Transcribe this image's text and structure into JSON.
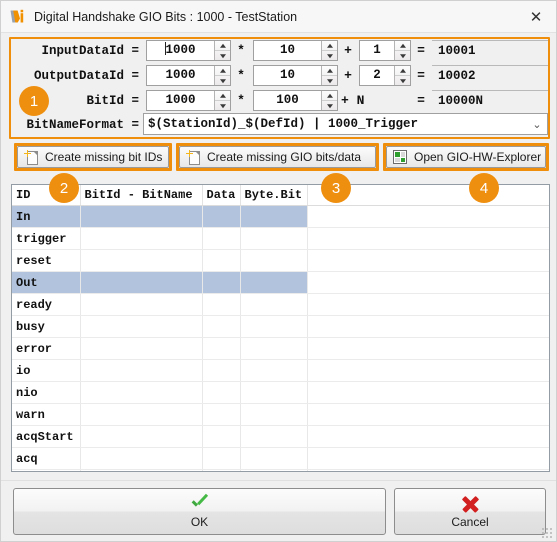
{
  "window": {
    "title": "Digital Handshake GIO Bits : 1000 - TestStation",
    "icon": "app-logo-icon",
    "close_label": "✕"
  },
  "accent_color": "#ef8f10",
  "selection_color": "#b2c4dd",
  "formula": {
    "rows": [
      {
        "label": "InputDataId =",
        "base": "1000",
        "mul_op": "*",
        "factor": "10",
        "add_op": "+",
        "offset": "1",
        "eq_op": "=",
        "result": "10001",
        "has_caret": true,
        "offset_is_spinner": true
      },
      {
        "label": "OutputDataId =",
        "base": "1000",
        "mul_op": "*",
        "factor": "10",
        "add_op": "+",
        "offset": "2",
        "eq_op": "=",
        "result": "10002",
        "has_caret": false,
        "offset_is_spinner": true
      },
      {
        "label": "BitId =",
        "base": "1000",
        "mul_op": "*",
        "factor": "100",
        "add_op": "+ N",
        "offset": "",
        "eq_op": "=",
        "result": "10000N",
        "has_caret": false,
        "offset_is_spinner": false
      }
    ],
    "bitnameformat": {
      "label": "BitNameFormat =",
      "value": "$(StationId)_$(DefId) | 1000_Trigger",
      "arrow": "⌄"
    }
  },
  "actions": [
    {
      "label": "Create missing bit IDs",
      "icon": "new-document-icon"
    },
    {
      "label": "Create missing GIO bits/data",
      "icon": "new-document-icon"
    },
    {
      "label": "Open GIO-HW-Explorer",
      "icon": "grid-explorer-icon"
    }
  ],
  "badges": [
    "1",
    "2",
    "3",
    "4"
  ],
  "table": {
    "columns": [
      "ID",
      "BitId - BitName",
      "Data",
      "Byte.Bit",
      ""
    ],
    "rows": [
      {
        "id": "In",
        "bit": "",
        "data": "",
        "bytebit": "",
        "selected": true
      },
      {
        "id": "trigger",
        "bit": "",
        "data": "",
        "bytebit": "",
        "selected": false
      },
      {
        "id": "reset",
        "bit": "",
        "data": "",
        "bytebit": "",
        "selected": false
      },
      {
        "id": "Out",
        "bit": "",
        "data": "",
        "bytebit": "",
        "selected": true
      },
      {
        "id": "ready",
        "bit": "",
        "data": "",
        "bytebit": "",
        "selected": false
      },
      {
        "id": "busy",
        "bit": "",
        "data": "",
        "bytebit": "",
        "selected": false
      },
      {
        "id": "error",
        "bit": "",
        "data": "",
        "bytebit": "",
        "selected": false
      },
      {
        "id": "io",
        "bit": "",
        "data": "",
        "bytebit": "",
        "selected": false
      },
      {
        "id": "nio",
        "bit": "",
        "data": "",
        "bytebit": "",
        "selected": false
      },
      {
        "id": "warn",
        "bit": "",
        "data": "",
        "bytebit": "",
        "selected": false
      },
      {
        "id": "acqStart",
        "bit": "",
        "data": "",
        "bytebit": "",
        "selected": false
      },
      {
        "id": "acq",
        "bit": "",
        "data": "",
        "bytebit": "",
        "selected": false
      },
      {
        "id": "",
        "bit": "",
        "data": "",
        "bytebit": "",
        "selected": false
      },
      {
        "id": "",
        "bit": "",
        "data": "",
        "bytebit": "",
        "selected": false
      },
      {
        "id": "",
        "bit": "",
        "data": "",
        "bytebit": "",
        "selected": false
      }
    ]
  },
  "footer": {
    "ok_label": "OK",
    "cancel_label": "Cancel",
    "ok_icon": "green-check-icon",
    "cancel_icon": "red-cross-icon"
  }
}
